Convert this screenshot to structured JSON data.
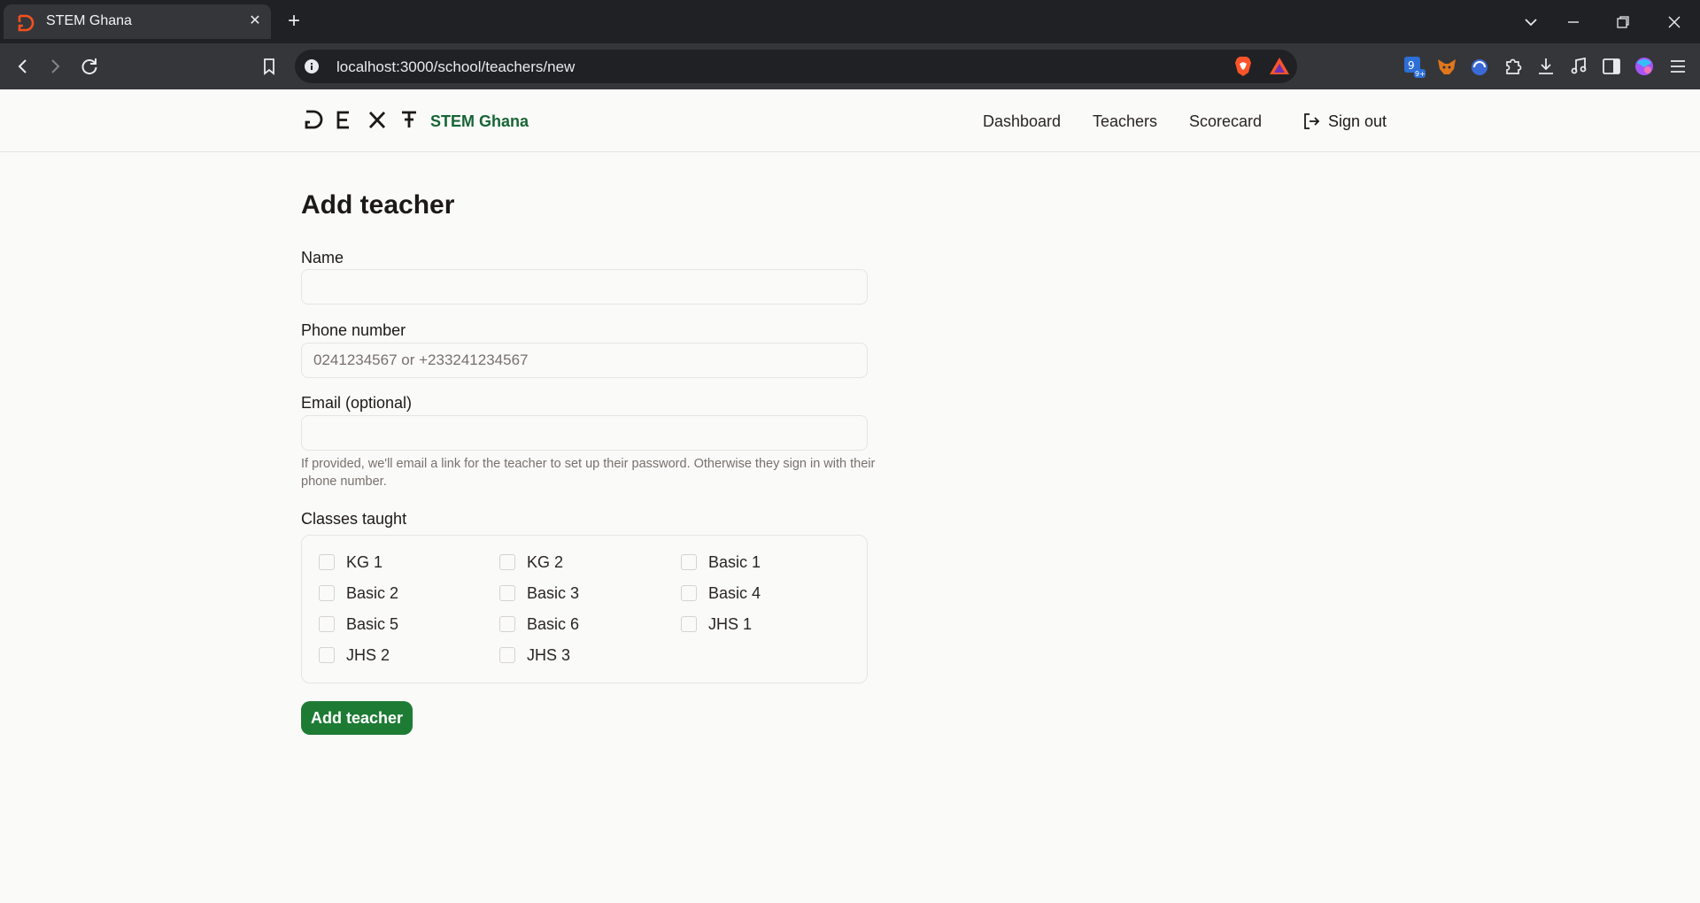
{
  "browser": {
    "tab_title": "STEM Ghana",
    "url": "localhost:3000/school/teachers/new",
    "colors": {
      "chrome_dark": "#202124",
      "chrome_mid": "#35363a",
      "brave_orange": "#fb542b"
    }
  },
  "header": {
    "logo_text": "DEXT",
    "school_name": "STEM Ghana",
    "nav": [
      "Dashboard",
      "Teachers",
      "Scorecard"
    ],
    "sign_out": "Sign out"
  },
  "form": {
    "title": "Add teacher",
    "name_label": "Name",
    "name_value": "",
    "phone_label": "Phone number",
    "phone_placeholder": "0241234567 or +233241234567",
    "email_label": "Email (optional)",
    "email_value": "",
    "email_help": "If provided, we'll email a link for the teacher to set up their password. Otherwise they sign in with their phone number.",
    "classes_label": "Classes taught",
    "classes": [
      "KG 1",
      "KG 2",
      "Basic 1",
      "Basic 2",
      "Basic 3",
      "Basic 4",
      "Basic 5",
      "Basic 6",
      "JHS 1",
      "JHS 2",
      "JHS 3"
    ],
    "submit": "Add teacher"
  },
  "colors": {
    "accent_green": "#1e7b34",
    "school_green": "#166534"
  }
}
